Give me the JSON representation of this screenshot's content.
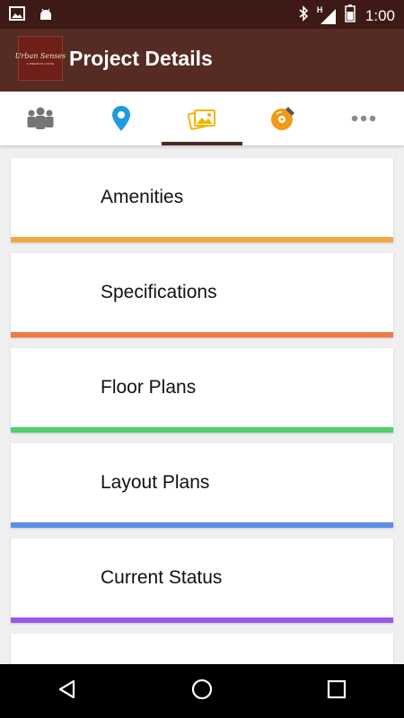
{
  "status_bar": {
    "time": "1:00",
    "network_label": "H",
    "icons": [
      "image-icon",
      "android-icon",
      "bluetooth-icon",
      "signal-icon",
      "battery-icon"
    ]
  },
  "app_bar": {
    "title": "Project Details",
    "logo_text": "Urban Senses",
    "logo_subtext": "A PREMIUM LIVING"
  },
  "tabs": [
    {
      "icon": "people-icon",
      "color": "#757575",
      "active": false
    },
    {
      "icon": "location-pin-icon",
      "color": "#1e9be0",
      "active": false
    },
    {
      "icon": "gallery-icon",
      "color": "#f4b400",
      "active": true
    },
    {
      "icon": "disc-icon",
      "color": "#f29a17",
      "active": false
    },
    {
      "icon": "more-icon",
      "color": "#8a8a8a",
      "active": false
    }
  ],
  "items": [
    {
      "label": "Amenities",
      "color": "#f4a742"
    },
    {
      "label": "Specifications",
      "color": "#f07a45"
    },
    {
      "label": "Floor Plans",
      "color": "#4fd06d"
    },
    {
      "label": "Layout Plans",
      "color": "#5b8eea"
    },
    {
      "label": "Current Status",
      "color": "#9a57e6"
    }
  ],
  "nav": {
    "buttons": [
      "back-icon",
      "home-icon",
      "recents-icon"
    ]
  }
}
